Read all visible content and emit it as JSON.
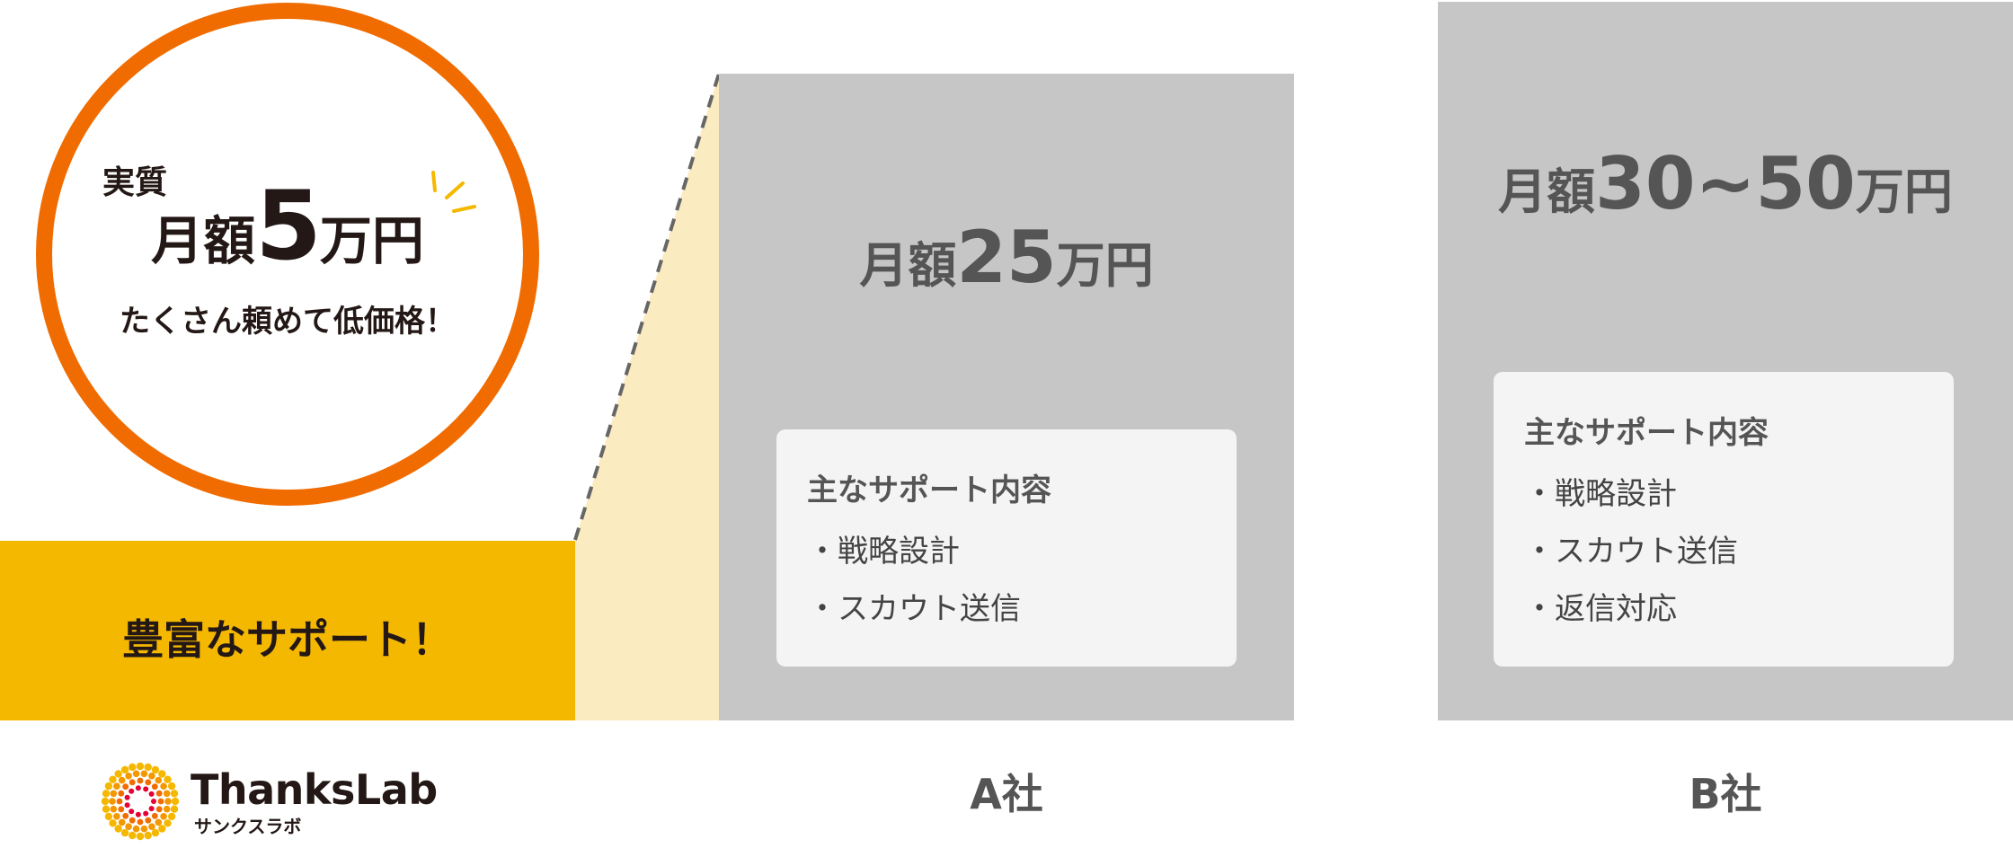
{
  "colors": {
    "orange_ring": "#F06C00",
    "gold": "#F5B800",
    "pale_yellow": "#FBEBC1",
    "gray_column": "#C6C6C6",
    "card_bg": "#F4F4F4",
    "text_dark": "#231815",
    "text_gray": "#555555"
  },
  "thankslab": {
    "label": "実質",
    "price_prefix": "月額",
    "price_number": "5",
    "price_suffix": "万円",
    "tagline": "たくさん頼めて低価格！",
    "support_label": "豊富なサポート！",
    "logo_name": "ThanksLab",
    "logo_kana": "サンクスラボ"
  },
  "company_a": {
    "price_prefix": "月額",
    "price_number": "25",
    "price_suffix": "万円",
    "card_title": "主なサポート内容",
    "items": [
      "・戦略設計",
      "・スカウト送信"
    ],
    "name": "A社"
  },
  "company_b": {
    "price_prefix": "月額",
    "price_number": "30~50",
    "price_suffix": "万円",
    "card_title": "主なサポート内容",
    "items": [
      "・戦略設計",
      "・スカウト送信",
      "・返信対応"
    ],
    "name": "B社"
  }
}
